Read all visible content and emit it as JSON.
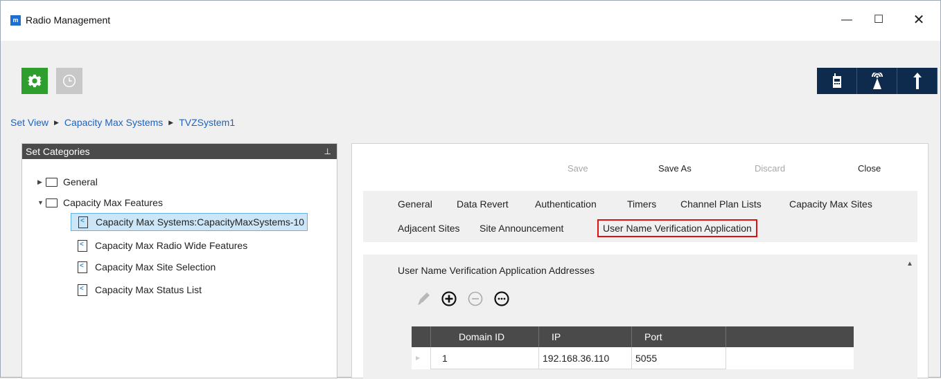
{
  "window": {
    "app_icon": "radio-management-icon",
    "title": "Radio Management",
    "min_glyph": "—",
    "max_glyph": "☐",
    "close_glyph": "✕"
  },
  "toolbar": {
    "settings_icon": "gear-icon",
    "history_icon": "clock-icon",
    "right_icons": [
      "radio-device-icon",
      "tower-icon",
      "antenna-icon"
    ]
  },
  "breadcrumb": {
    "items": [
      "Set View",
      "Capacity Max Systems",
      "TVZSystem1"
    ],
    "separator": "▶"
  },
  "set_categories": {
    "header": "Set Categories",
    "pin": "⊥",
    "general": "General",
    "features": "Capacity Max Features",
    "items": [
      "Capacity Max Systems:CapacityMaxSystems-10",
      "Capacity Max Radio Wide Features",
      "Capacity Max Site Selection",
      "Capacity Max Status List"
    ],
    "selected_index": 0
  },
  "actions": {
    "save": "Save",
    "save_as": "Save As",
    "discard": "Discard",
    "close": "Close"
  },
  "tabs": {
    "row1": [
      "General",
      "Data Revert",
      "Authentication",
      "Timers",
      "Channel Plan Lists",
      "Capacity Max Sites"
    ],
    "row2": [
      "Adjacent Sites",
      "Site Announcement",
      "User Name Verification Application"
    ],
    "active": "User Name Verification Application"
  },
  "content": {
    "section_title": "User Name Verification Application Addresses",
    "icons": [
      "edit-icon",
      "add-icon",
      "remove-icon",
      "more-icon"
    ],
    "grid": {
      "columns": [
        "Domain ID",
        "IP",
        "Port"
      ],
      "rows": [
        {
          "domain_id": "1",
          "ip": "192.168.36.110",
          "port": "5055"
        }
      ]
    }
  },
  "colors": {
    "accent_green": "#2e9e2e",
    "nav_dark": "#0e2a4d",
    "link_blue": "#1a63c4",
    "active_tab_border": "#e01010"
  }
}
